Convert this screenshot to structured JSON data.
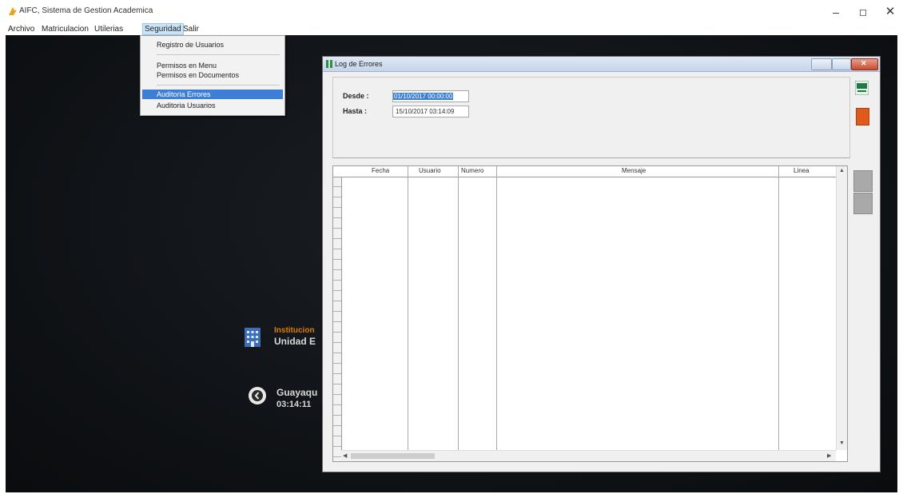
{
  "window": {
    "title": "AIFC, Sistema de Gestion Academica",
    "controls": [
      "–",
      "◻",
      "✕"
    ]
  },
  "menu": [
    "Archivo",
    "Matriculacion",
    "Utilerias",
    "Seguridad",
    "Salir"
  ],
  "dropdown": {
    "items": [
      "Registro de Usuarios",
      "Permisos en Menu",
      "Permisos en Documentos",
      "Auditoria Errores",
      "Auditoria Usuarios"
    ],
    "selected_index": 3
  },
  "desktop": {
    "institution_label": "Institucion",
    "institution_name": "Unidad E",
    "city": "Guayaqu",
    "time": "03:14:11"
  },
  "log_window": {
    "title": "Log de Errores",
    "desde_label": "Desde :",
    "desde_value": "01/10/2017 00:00:00",
    "hasta_label": "Hasta :",
    "hasta_value": "15/10/2017 03:14:09",
    "columns": [
      "Fecha",
      "Usuario",
      "Numero",
      "Mensaje",
      "Linea"
    ]
  },
  "colors": {
    "selection": "#3d7fd6",
    "institution_label": "#e07b00",
    "exit_button": "#e05a1c"
  },
  "icons": [
    "app-icon",
    "excel-icon",
    "exit-icon",
    "building-icon",
    "clock-icon"
  ]
}
